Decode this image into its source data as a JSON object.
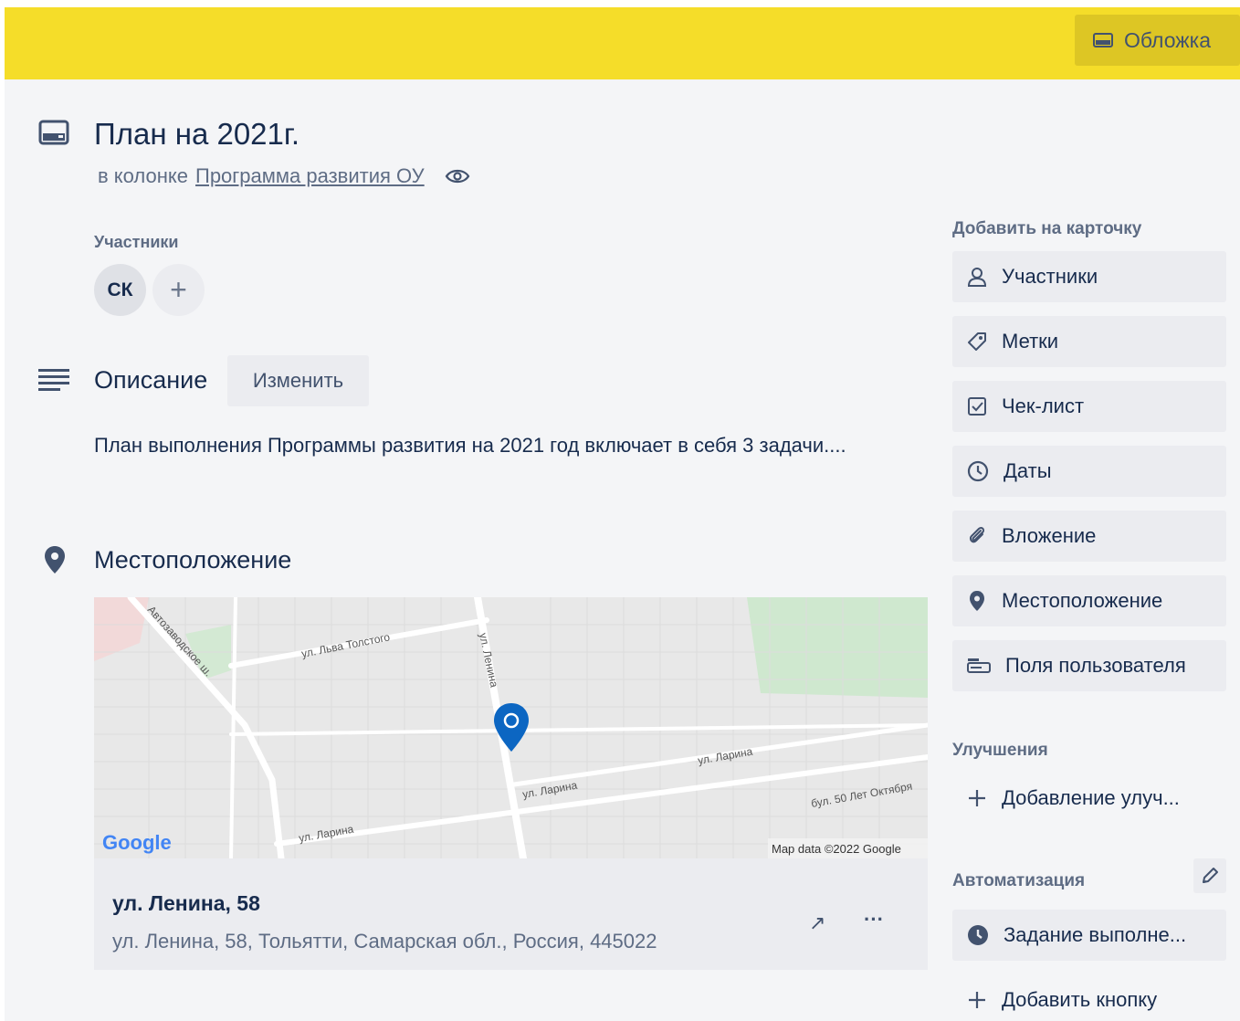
{
  "cover": {
    "button_label": "Обложка",
    "color": "#f5dd29"
  },
  "card": {
    "title": "План на 2021г.",
    "in_list_prefix": "в колонке",
    "list_name": "Программа развития ОУ"
  },
  "members": {
    "heading": "Участники",
    "avatar_initials": "СК",
    "add_symbol": "+"
  },
  "description": {
    "heading": "Описание",
    "edit_label": "Изменить",
    "text": "План выполнения Программы развития на 2021 год включает в себя 3 задачи...."
  },
  "location": {
    "heading": "Местоположение",
    "map": {
      "streets": [
        "ул. Льва Толстого",
        "ул. Ленина",
        "Автозаводское ш.",
        "ул. Ларина",
        "ул. Ларина",
        "ул. Ларина",
        "бул. 50 Лет Октября"
      ],
      "attribution": "Map data ©2022 Google",
      "logo": "Google"
    },
    "place_name": "ул. Ленина, 58",
    "address": "ул. Ленина, 58, Тольятти, Самарская обл., Россия, 445022",
    "open_symbol": "↗",
    "more_symbol": "···"
  },
  "sidebar": {
    "add_heading": "Добавить на карточку",
    "add_items": [
      {
        "label": "Участники",
        "icon": "person-icon"
      },
      {
        "label": "Метки",
        "icon": "tag-icon"
      },
      {
        "label": "Чек-лист",
        "icon": "checklist-icon"
      },
      {
        "label": "Даты",
        "icon": "clock-icon"
      },
      {
        "label": "Вложение",
        "icon": "paperclip-icon"
      },
      {
        "label": "Местоположение",
        "icon": "location-pin-icon"
      },
      {
        "label": "Поля пользователя",
        "icon": "custom-fields-icon"
      }
    ],
    "powerups_heading": "Улучшения",
    "powerups_add": "Добавление улуч...",
    "automation_heading": "Автоматизация",
    "automation_items": [
      {
        "label": "Задание выполне...",
        "icon": "clock-filled-icon"
      }
    ],
    "add_button": "Добавить кнопку"
  }
}
